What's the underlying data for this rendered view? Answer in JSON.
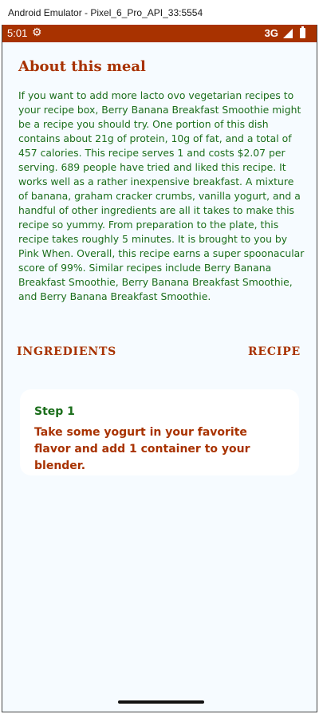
{
  "window": {
    "title": "Android Emulator - Pixel_6_Pro_API_33:5554"
  },
  "status_bar": {
    "time": "5:01",
    "settings_icon": "gear-icon",
    "network": "3G",
    "signal_icon": "signal-icon",
    "battery_icon": "battery-icon"
  },
  "about": {
    "title": "About this meal",
    "text": "If you want to add more lacto ovo vegetarian recipes to your recipe box, Berry Banana Breakfast Smoothie might be a recipe you should try. One portion of this dish contains about 21g of protein, 10g of fat, and a total of 457 calories. This recipe serves 1 and costs $2.07 per serving. 689 people have tried and liked this recipe. It works well as a rather inexpensive breakfast. A mixture of banana, graham cracker crumbs, vanilla yogurt, and a handful of other ingredients are all it takes to make this recipe so yummy. From preparation to the plate, this recipe takes roughly 5 minutes. It is brought to you by Pink When. Overall, this recipe earns a super spoonacular score of 99%. Similar recipes include Berry Banana Breakfast Smoothie, Berry Banana Breakfast Smoothie, and Berry Banana Breakfast Smoothie."
  },
  "tabs": {
    "ingredients": "INGREDIENTS",
    "recipe": "RECIPE"
  },
  "step": {
    "label": "Step 1",
    "text": "Take some yogurt in your favorite flavor and add 1 container to your blender."
  },
  "colors": {
    "brand": "#a83200",
    "accent_green": "#1b6e1b",
    "background": "#f6fbff"
  }
}
